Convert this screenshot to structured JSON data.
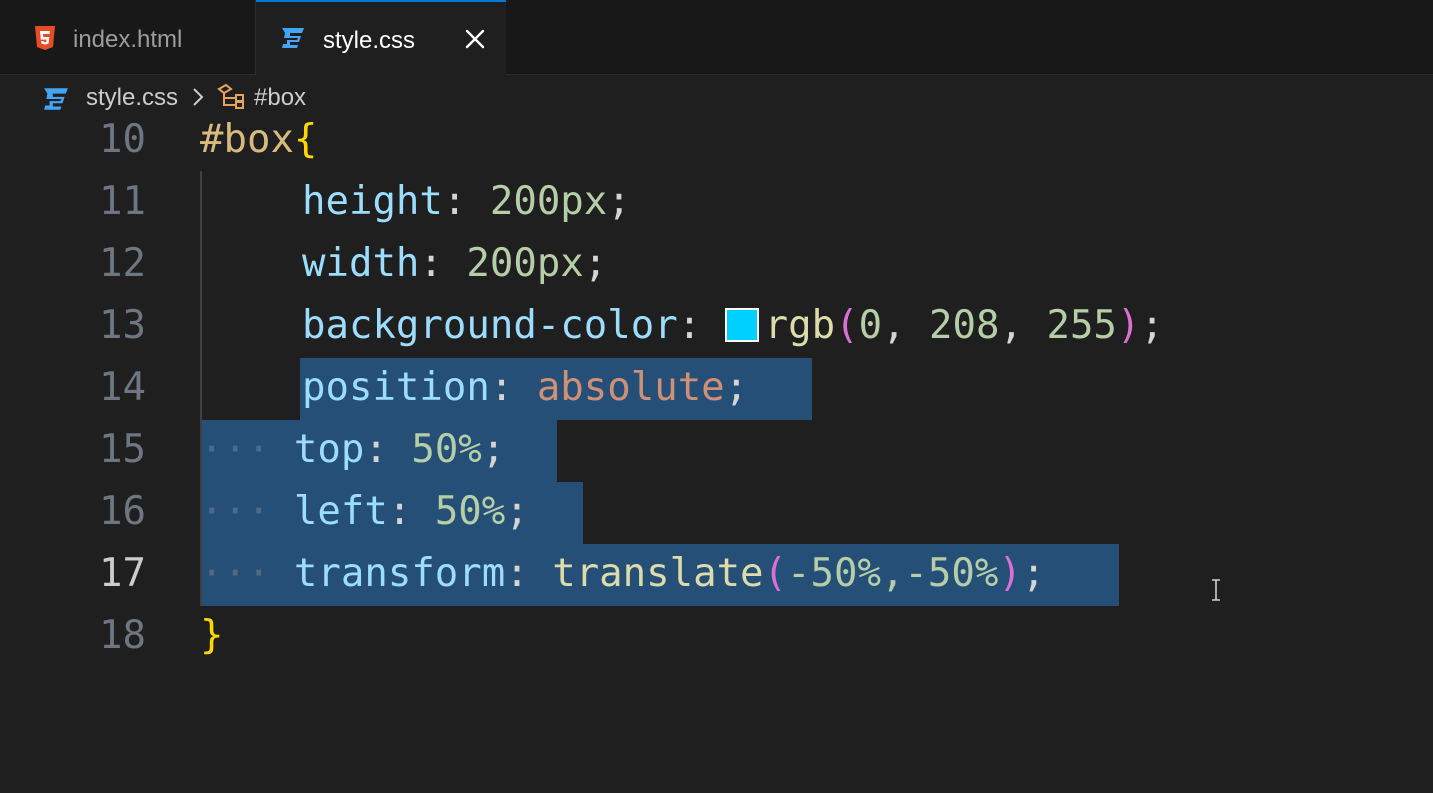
{
  "tabs": [
    {
      "label": "index.html",
      "icon": "html5-icon",
      "active": false
    },
    {
      "label": "style.css",
      "icon": "css3-icon",
      "active": true,
      "close_icon": "close-icon"
    }
  ],
  "breadcrumb": {
    "file": "style.css",
    "selector": "#box"
  },
  "editor": {
    "active_line": "17",
    "lines": [
      {
        "number": "10",
        "parts": [
          "#box",
          "{"
        ]
      },
      {
        "number": "11",
        "parts": [
          "height",
          ": ",
          "200px",
          ";"
        ]
      },
      {
        "number": "12",
        "parts": [
          "width",
          ": ",
          "200px",
          ";"
        ]
      },
      {
        "number": "13",
        "parts": [
          "background-color",
          ": ",
          "rgb",
          "(",
          "0",
          ", ",
          "208",
          ", ",
          "255",
          ")",
          ";"
        ]
      },
      {
        "number": "14",
        "parts": [
          "position",
          ": ",
          "absolute",
          ";"
        ]
      },
      {
        "number": "15",
        "parts": [
          "top",
          ": ",
          "50%",
          ";"
        ]
      },
      {
        "number": "16",
        "parts": [
          "left",
          ": ",
          "50%",
          ";"
        ]
      },
      {
        "number": "17",
        "parts": [
          "transform",
          ": ",
          "translate",
          "(",
          "-50%,-50%",
          ")",
          ";"
        ]
      },
      {
        "number": "18",
        "parts": [
          "}"
        ]
      }
    ],
    "color_swatch": "#00d0ff"
  },
  "colors": {
    "accent": "#0078d4",
    "selection": "#264f78",
    "html_icon": "#e44d26",
    "css_icon": "#42a5f5"
  }
}
